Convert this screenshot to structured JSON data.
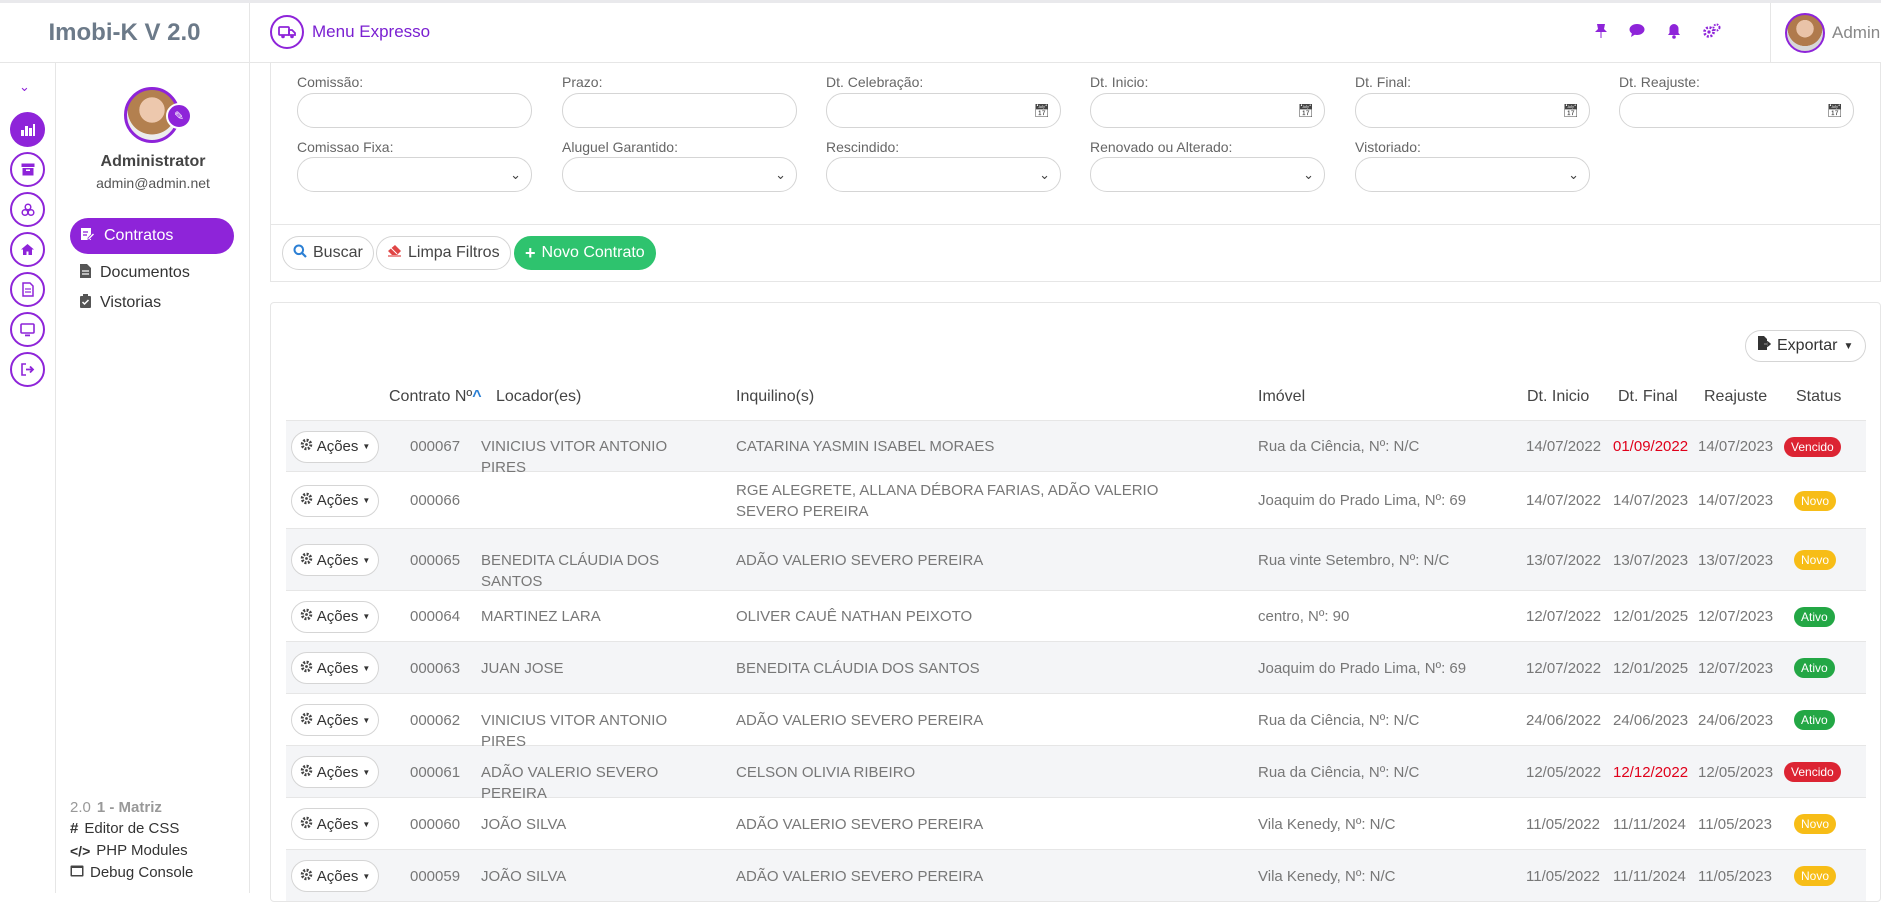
{
  "app": {
    "title": "Imobi-K V 2.0"
  },
  "topbar": {
    "menu_expresso": "Menu Expresso",
    "user_name": "Administrator"
  },
  "profile": {
    "name": "Administrator",
    "email": "admin@admin.net"
  },
  "sidebar": {
    "items": [
      {
        "label": "Contratos"
      },
      {
        "label": "Documentos"
      },
      {
        "label": "Vistorias"
      }
    ]
  },
  "footer": {
    "version": "2.0",
    "unit": "1 - Matriz",
    "links": [
      "Editor de CSS",
      "PHP Modules",
      "Debug Console"
    ]
  },
  "filters": {
    "comissao": "Comissão:",
    "prazo": "Prazo:",
    "dt_celebracao": "Dt. Celebração:",
    "dt_inicio": "Dt. Inicio:",
    "dt_final": "Dt. Final:",
    "dt_reajuste": "Dt. Reajuste:",
    "comissao_fixa": "Comissao Fixa:",
    "aluguel_garantido": "Aluguel Garantido:",
    "rescindido": "Rescindido:",
    "renovado": "Renovado ou Alterado:",
    "vistoriado": "Vistoriado:"
  },
  "actions": {
    "buscar": "Buscar",
    "limpa": "Limpa Filtros",
    "novo": "Novo Contrato",
    "exportar": "Exportar"
  },
  "table": {
    "headers": {
      "contrato": "Contrato Nº",
      "locador": "Locador(es)",
      "inquilino": "Inquilino(s)",
      "imovel": "Imóvel",
      "dt_inicio": "Dt. Inicio",
      "dt_final": "Dt. Final",
      "reajuste": "Reajuste",
      "status": "Status"
    },
    "acoes_label": "Ações",
    "rows": [
      {
        "id": "000067",
        "locador": "VINICIUS VITOR ANTONIO PIRES",
        "inquilino": "CATARINA YASMIN ISABEL MORAES",
        "imovel": "Rua da Ciência, Nº: N/C",
        "inicio": "14/07/2022",
        "final": "01/09/2022",
        "reajuste": "14/07/2023",
        "status": "Vencido"
      },
      {
        "id": "000066",
        "locador": "",
        "inquilino": "RGE ALEGRETE, ALLANA DÉBORA FARIAS, ADÃO VALERIO SEVERO PEREIRA",
        "imovel": "Joaquim do Prado Lima, Nº: 69",
        "inicio": "14/07/2022",
        "final": "14/07/2023",
        "reajuste": "14/07/2023",
        "status": "Novo"
      },
      {
        "id": "000065",
        "locador": "BENEDITA CLÁUDIA DOS SANTOS",
        "inquilino": "ADÃO VALERIO SEVERO PEREIRA",
        "imovel": "Rua vinte Setembro, Nº: N/C",
        "inicio": "13/07/2022",
        "final": "13/07/2023",
        "reajuste": "13/07/2023",
        "status": "Novo"
      },
      {
        "id": "000064",
        "locador": "MARTINEZ LARA",
        "inquilino": "OLIVER CAUÊ NATHAN PEIXOTO",
        "imovel": "centro, Nº: 90",
        "inicio": "12/07/2022",
        "final": "12/01/2025",
        "reajuste": "12/07/2023",
        "status": "Ativo"
      },
      {
        "id": "000063",
        "locador": "JUAN JOSE",
        "inquilino": "BENEDITA CLÁUDIA DOS SANTOS",
        "imovel": "Joaquim do Prado Lima, Nº: 69",
        "inicio": "12/07/2022",
        "final": "12/01/2025",
        "reajuste": "12/07/2023",
        "status": "Ativo"
      },
      {
        "id": "000062",
        "locador": "VINICIUS VITOR ANTONIO PIRES",
        "inquilino": "ADÃO VALERIO SEVERO PEREIRA",
        "imovel": "Rua da Ciência, Nº: N/C",
        "inicio": "24/06/2022",
        "final": "24/06/2023",
        "reajuste": "24/06/2023",
        "status": "Ativo"
      },
      {
        "id": "000061",
        "locador": "ADÃO VALERIO SEVERO PEREIRA",
        "inquilino": "CELSON OLIVIA RIBEIRO",
        "imovel": "Rua da Ciência, Nº: N/C",
        "inicio": "12/05/2022",
        "final": "12/12/2022",
        "reajuste": "12/05/2023",
        "status": "Vencido"
      },
      {
        "id": "000060",
        "locador": "JOÃO SILVA",
        "inquilino": "ADÃO VALERIO SEVERO PEREIRA",
        "imovel": "Vila Kenedy, Nº: N/C",
        "inicio": "11/05/2022",
        "final": "11/11/2024",
        "reajuste": "11/05/2023",
        "status": "Novo"
      },
      {
        "id": "000059",
        "locador": "JOÃO SILVA",
        "inquilino": "ADÃO VALERIO SEVERO PEREIRA",
        "imovel": "Vila Kenedy, Nº: N/C",
        "inicio": "11/05/2022",
        "final": "11/11/2024",
        "reajuste": "11/05/2023",
        "status": "Novo"
      }
    ]
  },
  "icons": {
    "rail": [
      "chart-icon",
      "archive-icon",
      "network-icon",
      "home-icon",
      "file-icon",
      "monitor-icon",
      "logout-icon"
    ]
  },
  "colors": {
    "accent": "#8e24d9",
    "green": "#2ec36e",
    "vencido": "#dc2433",
    "novo": "#f7bd17",
    "ativo": "#23a745"
  }
}
